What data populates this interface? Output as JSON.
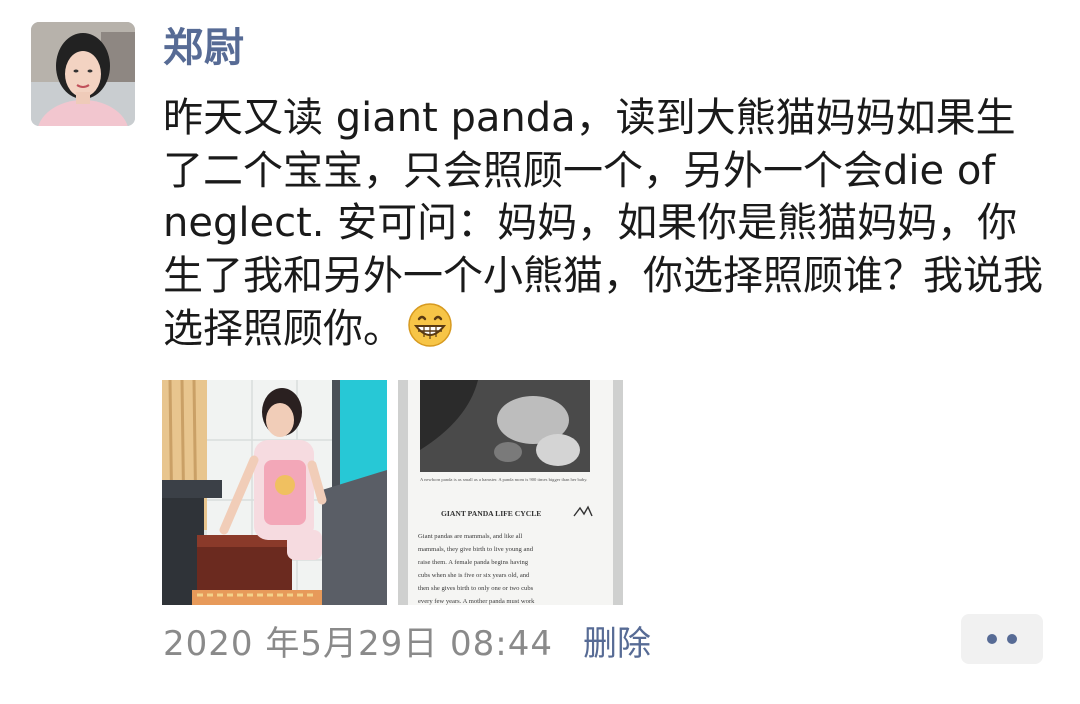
{
  "post": {
    "author": "郑尉",
    "content": "昨天又读 giant panda，读到大熊猫妈妈如果生了二个宝宝，只会照顾一个，另外一个会die of neglect. 安可问：妈妈，如果你是熊猫妈妈，你生了我和另外一个小熊猫，你选择照顾谁？我说我选择照顾你。",
    "emoji": "grinning-face-emoji",
    "images": [
      {
        "description": "child-sitting-photo"
      },
      {
        "description": "book-page-photo",
        "caption": "A newborn panda is as small as a hamster. A panda mom is 900 times bigger than her baby.",
        "heading": "GIANT PANDA LIFE CYCLE",
        "body": "Giant pandas are mammals, and like all mammals, they give birth to live young and raise them. A female panda begins having cubs when she is five or six years old, and then she gives birth to only one or two cubs every few years. A mother panda must work"
      }
    ],
    "timestamp": "2020 年5月29日 08:44",
    "delete_label": "删除"
  },
  "colors": {
    "link": "#576b95",
    "text": "#1a1a1a",
    "meta": "#8a8a8a",
    "more_bg": "#f1f1f1"
  }
}
